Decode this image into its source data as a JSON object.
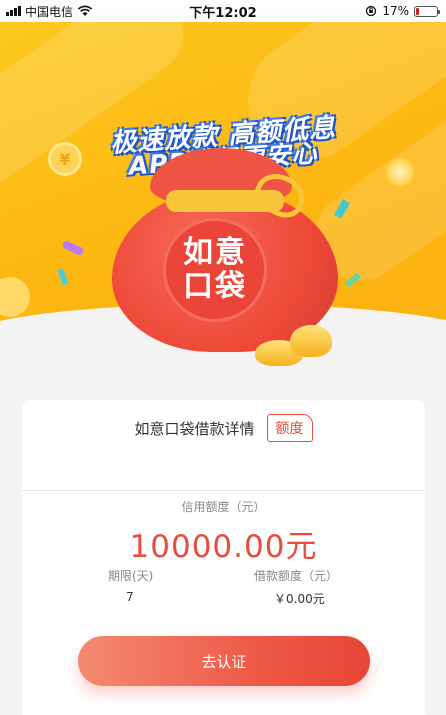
{
  "status_bar": {
    "carrier": "中国电信",
    "time": "下午12:02",
    "battery_percent": "17%",
    "battery_level": 0.17,
    "icons": [
      "signal-icon",
      "wifi-icon",
      "rotation-lock-icon",
      "battery-icon"
    ]
  },
  "banner": {
    "headline_1": "极速放款 高额低息",
    "headline_2": "APP升级更安心",
    "seal_line_1": "如意",
    "seal_line_2": "口袋",
    "coin_symbol": "¥",
    "colors": {
      "background": "#fcc91e",
      "pouch": "#ee4a3a",
      "headline_outline": "#1e56c9"
    }
  },
  "card": {
    "title": "如意口袋借款详情",
    "badge": "额度",
    "credit_label": "信用额度（元）",
    "credit_amount": "10000.00元",
    "term_label": "期限(天)",
    "term_value": "7",
    "loan_label": "借款额度（元）",
    "loan_value": "￥0.00元",
    "cta_label": "去认证",
    "accent_color": "#e84c3d"
  }
}
